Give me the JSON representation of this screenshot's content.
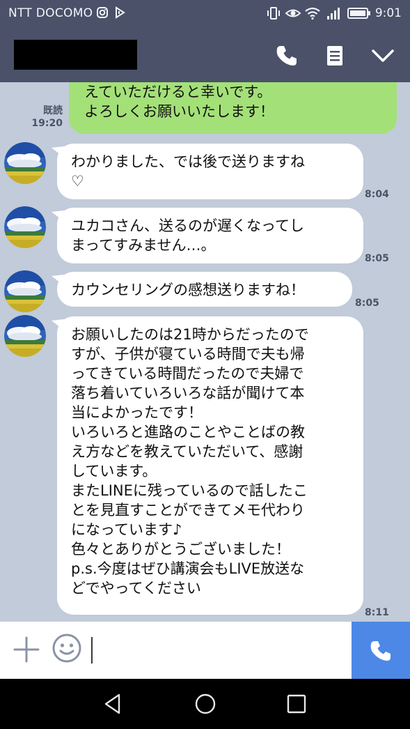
{
  "status_bar": {
    "carrier": "NTT DOCOMO",
    "time": "9:01",
    "icons": [
      "instagram-icon",
      "line-notification-icon",
      "vibrate-icon",
      "eye-comfort-icon",
      "wifi-icon",
      "signal-icon",
      "battery-icon"
    ]
  },
  "header": {
    "icons": [
      "phone-icon",
      "notes-icon",
      "chevron-down-icon"
    ]
  },
  "messages": [
    {
      "direction": "out",
      "text": "えていただけると幸いです。\nよろしくお願いいたします！",
      "read_label": "既読",
      "time": "19:20"
    },
    {
      "direction": "in",
      "text": "わかりました、では後で送りますね\n♡",
      "time": "8:04"
    },
    {
      "direction": "in",
      "text": "ユカコさん、送るのが遅くなってし\nまってすみません…。",
      "time": "8:05"
    },
    {
      "direction": "in",
      "text": "カウンセリングの感想送りますね！",
      "time": "8:05"
    },
    {
      "direction": "in",
      "text": "お願いしたのは21時からだったので\nすが、子供が寝ている時間で夫も帰\nってきている時間だったので夫婦で\n落ち着いていろいろな話が聞けて本\n当によかったです！\nいろいろと進路のことやことばの教\nえ方などを教えていただいて、感謝\nしています。\nまたLINEに残っているので話したこ\nとを見直すことができてメモ代わり\nになっています♪\n色々とありがとうございました！\np.s.今度はぜひ講演会もLIVE放送な\nどでやってください",
      "time": "8:11"
    }
  ],
  "input_bar": {
    "icons": [
      "plus-icon",
      "emoji-icon",
      "phone-icon"
    ]
  },
  "nav_bar": {
    "icons": [
      "back-icon",
      "home-icon",
      "recents-icon"
    ]
  },
  "colors": {
    "header_bg": "#4a5169",
    "chat_bg": "#c1cbd9",
    "outgoing_bubble": "#a4e078",
    "incoming_bubble": "#ffffff",
    "call_button": "#4d88e6"
  }
}
